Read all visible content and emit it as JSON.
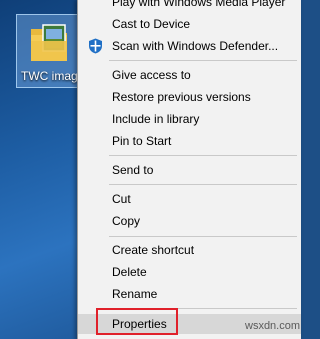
{
  "desktop": {
    "icon_label": "TWC image"
  },
  "menu": {
    "items": [
      {
        "label": "Play with Windows Media Player"
      },
      {
        "label": "Cast to Device"
      },
      {
        "label": "Scan with Windows Defender..."
      },
      {
        "label": "Give access to"
      },
      {
        "label": "Restore previous versions"
      },
      {
        "label": "Include in library"
      },
      {
        "label": "Pin to Start"
      },
      {
        "label": "Send to"
      },
      {
        "label": "Cut"
      },
      {
        "label": "Copy"
      },
      {
        "label": "Create shortcut"
      },
      {
        "label": "Delete"
      },
      {
        "label": "Rename"
      },
      {
        "label": "Properties"
      }
    ],
    "highlight_color": "#d7d7d7",
    "focus_box_color": "#e0202a"
  },
  "watermark": "wsxdn.com"
}
